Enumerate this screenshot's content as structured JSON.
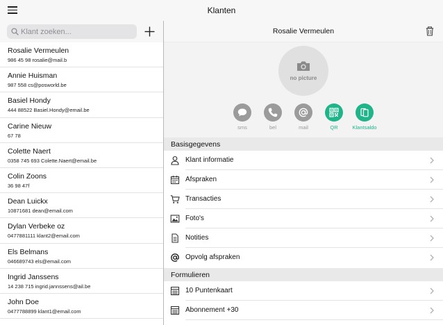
{
  "header": {
    "title": "Klanten"
  },
  "search": {
    "placeholder": "Klant zoeken..."
  },
  "customers": [
    {
      "name": "Rosalie Vermeulen",
      "info": "986 45 98 rosalie@mail.b"
    },
    {
      "name": "Annie Huisman",
      "info": "987 558  cs@posworld.be"
    },
    {
      "name": "Basiel Hondy",
      "info": "444 88522  Basiel.Hondy@email.be"
    },
    {
      "name": "Carine Nieuw",
      "info": "67 78"
    },
    {
      "name": "Colette Naert",
      "info": "0358 745 693  Colette.Naert@email.be"
    },
    {
      "name": "Colin Zoons",
      "info": "36 98 47f"
    },
    {
      "name": "Dean Luickx",
      "info": "10871681  dean@email.com"
    },
    {
      "name": "Dylan Verbeke oz",
      "info": "0477881111  klant2@email.com"
    },
    {
      "name": "Els Belmans",
      "info": "046689743  els@email.com"
    },
    {
      "name": "Ingrid Janssens",
      "info": "14 238 715  ingrid.jannssens@ail.be"
    },
    {
      "name": "John Doe",
      "info": "0477788899  klant1@email.com"
    }
  ],
  "detail": {
    "name": "Rosalie Vermeulen",
    "photo_label": "no picture",
    "actions": [
      {
        "label": "sms",
        "icon": "chat-bubble-icon",
        "active": false
      },
      {
        "label": "bel",
        "icon": "phone-icon",
        "active": false
      },
      {
        "label": "mail",
        "icon": "at-sign-icon",
        "active": false
      },
      {
        "label": "QR",
        "icon": "qr-code-icon",
        "active": true
      },
      {
        "label": "Klantsaldo",
        "icon": "cards-icon",
        "active": true
      }
    ],
    "active_color": "#1fb48a",
    "inactive_color": "#9b9b9b"
  },
  "sections": {
    "basis": {
      "title": "Basisgegevens",
      "items": [
        {
          "label": "Klant informatie",
          "icon": "person-icon"
        },
        {
          "label": "Afspraken",
          "icon": "calendar-icon"
        },
        {
          "label": "Transacties",
          "icon": "cart-icon"
        },
        {
          "label": "Foto's",
          "icon": "image-icon"
        },
        {
          "label": "Notities",
          "icon": "document-icon"
        },
        {
          "label": "Opvolg afspraken",
          "icon": "at-icon"
        }
      ]
    },
    "formulieren": {
      "title": "Formulieren",
      "items": [
        {
          "label": "10 Puntenkaart",
          "icon": "form-icon"
        },
        {
          "label": "Abonnement +30",
          "icon": "form-icon"
        }
      ]
    }
  }
}
